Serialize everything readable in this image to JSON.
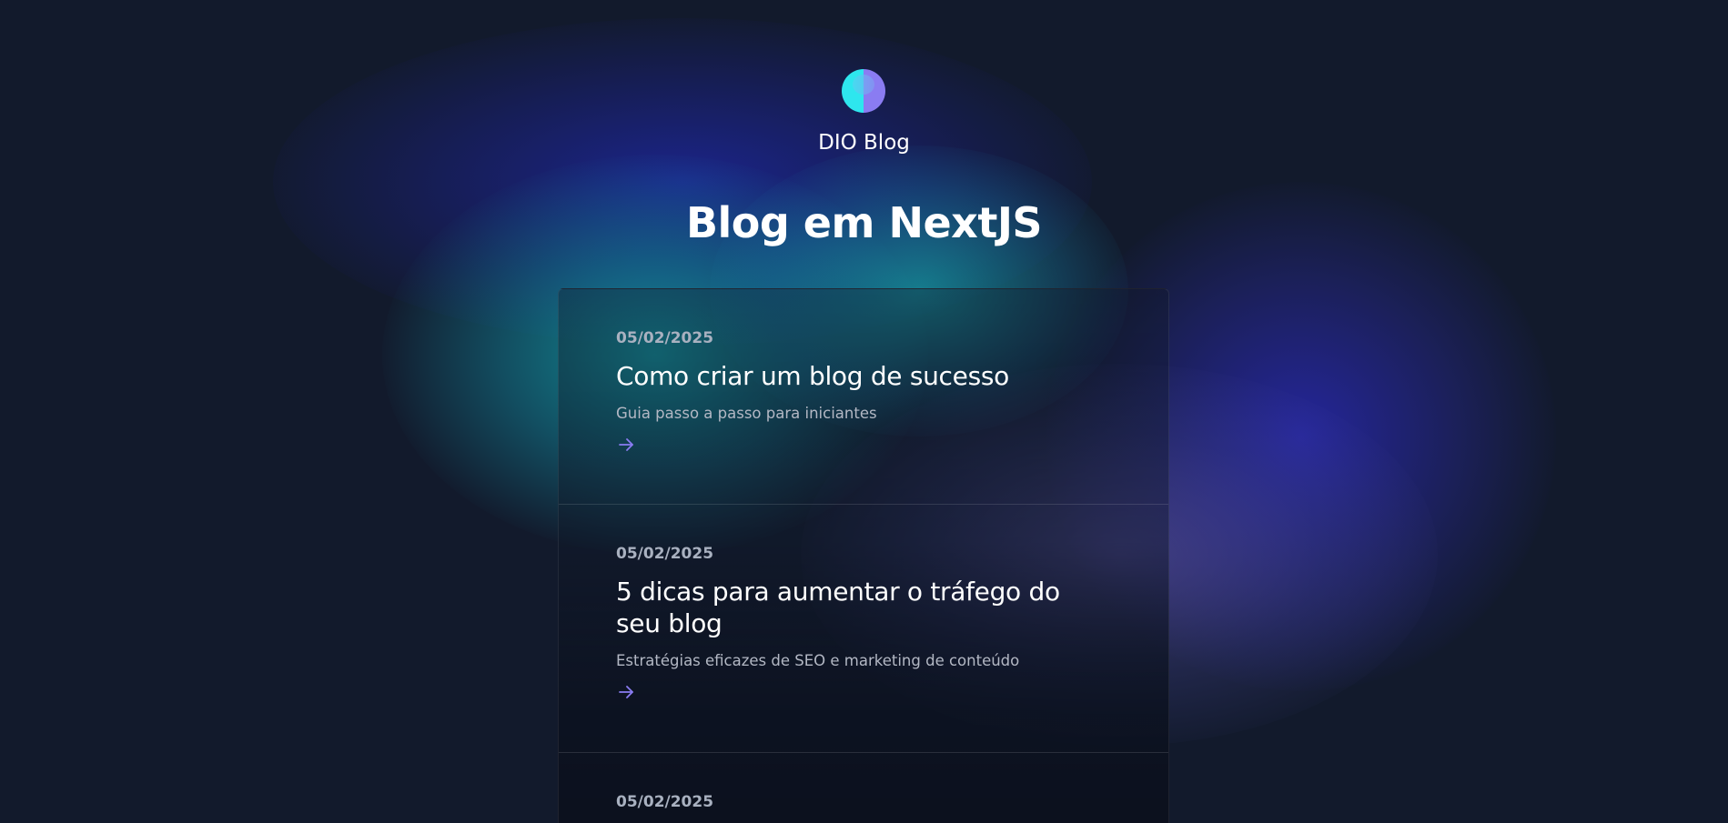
{
  "site": {
    "brand": "DIO Blog",
    "title": "Blog em NextJS",
    "logo_icon": "gradient-circle-logo-icon",
    "colors": {
      "background": "#121a2c",
      "accent": "#8a7cf2",
      "logo_left": "#2ee6ee",
      "logo_right": "#8a7cf2"
    }
  },
  "posts": [
    {
      "date": "05/02/2025",
      "title": "Como criar um blog de sucesso",
      "description": "Guia passo a passo para iniciantes",
      "icon": "arrow-right-icon"
    },
    {
      "date": "05/02/2025",
      "title": "5 dicas para aumentar o tráfego do seu blog",
      "description": "Estratégias eficazes de SEO e marketing de conteúdo",
      "icon": "arrow-right-icon"
    },
    {
      "date": "05/02/2025"
    }
  ]
}
